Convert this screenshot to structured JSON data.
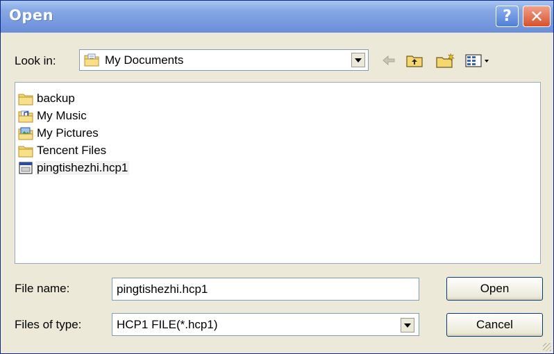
{
  "window": {
    "title": "Open",
    "help_label": "?",
    "close_label": "✕"
  },
  "look_in": {
    "label": "Look in:",
    "value": "My Documents",
    "icon": "my-documents-icon"
  },
  "toolbar": {
    "icons": [
      "back-arrow-icon",
      "up-one-level-icon",
      "new-folder-icon",
      "view-menu-icon"
    ]
  },
  "file_list": {
    "items": [
      {
        "label": "backup",
        "icon": "folder-icon"
      },
      {
        "label": "My Music",
        "icon": "music-folder-icon"
      },
      {
        "label": "My Pictures",
        "icon": "pictures-folder-icon"
      },
      {
        "label": "Tencent Files",
        "icon": "folder-icon"
      },
      {
        "label": "pingtishezhi.hcp1",
        "icon": "file-icon",
        "selected": true
      }
    ]
  },
  "file_name": {
    "label": "File name:",
    "value": "pingtishezhi.hcp1"
  },
  "file_type": {
    "label": "Files of type:",
    "value": "HCP1 FILE(*.hcp1)"
  },
  "buttons": {
    "open": "Open",
    "cancel": "Cancel"
  },
  "colors": {
    "titlebar": "#7a9de0",
    "dialog_bg": "#ece9d8",
    "close_button": "#d9502a",
    "folder": "#f5d76e"
  }
}
